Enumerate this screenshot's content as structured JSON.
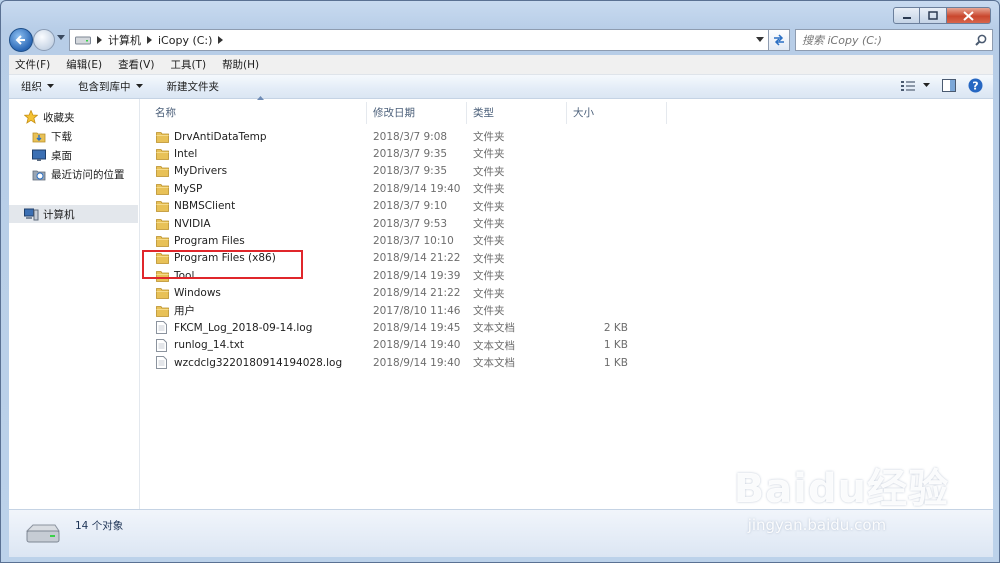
{
  "address": {
    "crumbs": [
      "计算机",
      "iCopy (C:)"
    ]
  },
  "search": {
    "placeholder": "搜索 iCopy (C:)"
  },
  "menu": [
    "文件(F)",
    "编辑(E)",
    "查看(V)",
    "工具(T)",
    "帮助(H)"
  ],
  "toolbar": {
    "organize": "组织",
    "include_library": "包含到库中",
    "new_folder": "新建文件夹"
  },
  "nav": {
    "favorites": "收藏夹",
    "downloads": "下载",
    "desktop": "桌面",
    "recent": "最近访问的位置",
    "computer": "计算机"
  },
  "columns": {
    "name": "名称",
    "date": "修改日期",
    "type": "类型",
    "size": "大小"
  },
  "files": [
    {
      "name": "DrvAntiDataTemp",
      "date": "2018/3/7 9:08",
      "type": "文件夹",
      "size": "",
      "kind": "folder"
    },
    {
      "name": "Intel",
      "date": "2018/3/7 9:35",
      "type": "文件夹",
      "size": "",
      "kind": "folder"
    },
    {
      "name": "MyDrivers",
      "date": "2018/3/7 9:35",
      "type": "文件夹",
      "size": "",
      "kind": "folder"
    },
    {
      "name": "MySP",
      "date": "2018/9/14 19:40",
      "type": "文件夹",
      "size": "",
      "kind": "folder"
    },
    {
      "name": "NBMSClient",
      "date": "2018/3/7 9:10",
      "type": "文件夹",
      "size": "",
      "kind": "folder"
    },
    {
      "name": "NVIDIA",
      "date": "2018/3/7 9:53",
      "type": "文件夹",
      "size": "",
      "kind": "folder"
    },
    {
      "name": "Program Files",
      "date": "2018/3/7 10:10",
      "type": "文件夹",
      "size": "",
      "kind": "folder"
    },
    {
      "name": "Program Files (x86)",
      "date": "2018/9/14 21:22",
      "type": "文件夹",
      "size": "",
      "kind": "folder"
    },
    {
      "name": "Tool",
      "date": "2018/9/14 19:39",
      "type": "文件夹",
      "size": "",
      "kind": "folder"
    },
    {
      "name": "Windows",
      "date": "2018/9/14 21:22",
      "type": "文件夹",
      "size": "",
      "kind": "folder"
    },
    {
      "name": "用户",
      "date": "2017/8/10 11:46",
      "type": "文件夹",
      "size": "",
      "kind": "folder"
    },
    {
      "name": "FKCM_Log_2018-09-14.log",
      "date": "2018/9/14 19:45",
      "type": "文本文档",
      "size": "2 KB",
      "kind": "file"
    },
    {
      "name": "runlog_14.txt",
      "date": "2018/9/14 19:40",
      "type": "文本文档",
      "size": "1 KB",
      "kind": "file"
    },
    {
      "name": "wzcdclg3220180914194028.log",
      "date": "2018/9/14 19:40",
      "type": "文本文档",
      "size": "1 KB",
      "kind": "file"
    }
  ],
  "status": {
    "count": "14 个对象"
  },
  "watermark": {
    "brand": "Baidu经验",
    "url": "jingyan.baidu.com"
  },
  "colors": {
    "highlight": "#e0262b",
    "folder": "#e8c157",
    "frame": "#b9d1ea"
  }
}
